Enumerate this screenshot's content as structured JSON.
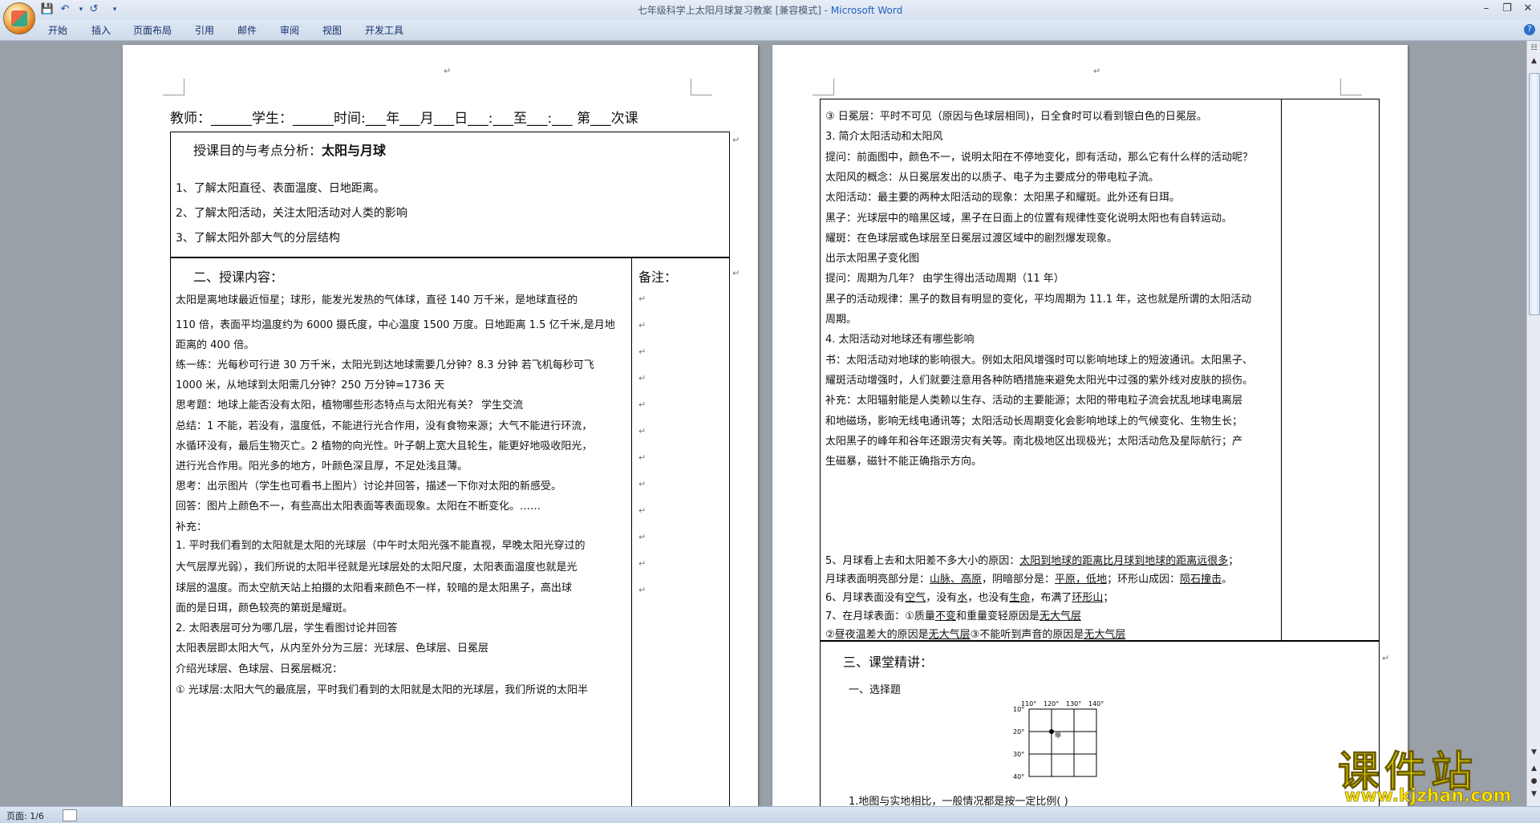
{
  "window": {
    "title": "七年级科学上太阳月球复习教案 [兼容模式] - ",
    "app_name": "Microsoft Word",
    "quick_access": [
      "save-icon",
      "undo-icon",
      "redo-icon",
      "customize-icon"
    ]
  },
  "ribbon": {
    "tabs": [
      "开始",
      "插入",
      "页面布局",
      "引用",
      "邮件",
      "审阅",
      "视图",
      "开发工具"
    ]
  },
  "page1": {
    "header_line": "教师：______学生：______时间:___年___月___日___:___至___:___   第___次课",
    "section1_title": "授课目的与考点分析：",
    "section1_topic": "太阳与月球",
    "goals": [
      "1、了解太阳直径、表面温度、日地距离。",
      "2、了解太阳活动，关注太阳活动对人类的影响",
      "3、了解太阳外部大气的分层结构"
    ],
    "section2_title": "二、授课内容：",
    "notes_label": "备注：",
    "content_lines": [
      "      太阳是离地球最近恒星；球形，能发光发热的气体球，直径 140 万千米，是地球直径的",
      "110 倍，表面平均温度约为 6000 摄氏度，中心温度 1500 万度。日地距离 1.5 亿千米,是月地",
      "距离的 400 倍。",
      "练一练：光每秒可行进 30 万千米，太阳光到达地球需要几分钟？8.3 分钟   若飞机每秒可飞",
      "1000 米，从地球到太阳需几分钟？250 万分钟=1736 天",
      "思考题：地球上能否没有太阳，植物哪些形态特点与太阳光有关？ 学生交流",
      "总结：1 不能，若没有，温度低，不能进行光合作用，没有食物来源；大气不能进行环流，",
      "水循环没有，最后生物灭亡。2 植物的向光性。叶子朝上宽大且轮生，能更好地吸收阳光，",
      "进行光合作用。阳光多的地方，叶颜色深且厚，不足处浅且薄。",
      "思考：出示图片（学生也可看书上图片）讨论并回答，描述一下你对太阳的新感受。",
      "回答：图片上颜色不一，有些高出太阳表面等表面现象。太阳在不断变化。……",
      "补充：",
      "1.  平时我们看到的太阳就是太阳的光球层（中午时太阳光强不能直视，早晚太阳光穿过的",
      "     大气层厚光弱），我们所说的太阳半径就是光球层处的太阳尺度，太阳表面温度也就是光",
      "     球层的温度。而太空航天站上拍摄的太阳看来颜色不一样，较暗的是太阳黑子，高出球",
      "     面的是日珥，颜色较亮的第斑是耀斑。",
      "2.  太阳表层可分为哪几层，学生看图讨论并回答",
      "太阳表层即太阳大气，从内至外分为三层：光球层、色球层、日冕层",
      "介绍光球层、色球层、日冕层概况：",
      "①  光球层:太阳大气的最底层，平时我们看到的太阳就是太阳的光球层，我们所说的太阳半"
    ]
  },
  "page2": {
    "content_lines": [
      "③  日冕层：平时不可见（原因与色球层相同)，日全食时可以看到银白色的日冕层。",
      "3. 简介太阳活动和太阳风",
      "提问：前面图中，颜色不一，说明太阳在不停地变化，即有活动，那么它有什么样的活动呢？",
      "太阳风的概念：从日冕层发出的以质子、电子为主要成分的带电粒子流。",
      "太阳活动：最主要的两种太阳活动的现象：太阳黑子和耀斑。此外还有日珥。",
      "黑子：光球层中的暗黑区域，黑子在日面上的位置有规律性变化说明太阳也有自转运动。",
      "耀斑：在色球层或色球层至日冕层过渡区域中的剧烈爆发现象。",
      "出示太阳黑子变化图",
      "提问：周期为几年？   由学生得出活动周期（11 年）",
      "黑子的活动规律：黑子的数目有明显的变化，平均周期为 11.1 年，这也就是所谓的太阳活动",
      "周期。",
      "4. 太阳活动对地球还有哪些影响",
      "书：太阳活动对地球的影响很大。例如太阳风增强时可以影响地球上的短波通讯。太阳黑子、",
      "耀斑活动增强时，人们就要注意用各种防晒措施来避免太阳光中过强的紫外线对皮肤的损伤。",
      "补充：太阳辐射能是人类赖以生存、活动的主要能源；太阳的带电粒子流会扰乱地球电离层",
      "和地磁场，影响无线电通讯等；太阳活动长周期变化会影响地球上的气候变化、生物生长；",
      "太阳黑子的峰年和谷年还跟涝灾有关等。南北极地区出现极光；太阳活动危及星际航行；产",
      "生磁暴，磁针不能正确指示方向。"
    ],
    "q5_a": "5、月球看上去和太阳差不多大小的原因：",
    "q5_b": "太阳到地球的距离比月球到地球的距离远很多",
    "q5_c": "月球表面明亮部分是：",
    "q5_d": "山脉、高原",
    "q5_e": "，阴暗部分是：",
    "q5_f": "平原，低地",
    "q5_g": "；环形山成因：",
    "q5_h": "陨石撞击",
    "q6_a": "6、月球表面没有",
    "q6_b": "空气",
    "q6_c": "，没有",
    "q6_d": "水",
    "q6_e": "，也没有",
    "q6_f": "生命",
    "q6_g": "，布满了",
    "q6_h": "环形山",
    "q7_a": "7、在月球表面：①质量",
    "q7_b": "不变",
    "q7_c": "和重量变轻原因是",
    "q7_d": "无大气层",
    "q7_e": "     ②昼夜温差大的原因是",
    "q7_f": "无大气层",
    "q7_g": "③不能听到声音的原因是",
    "q7_h": "无大气层",
    "section3_title": "三、课堂精讲：",
    "mc_title": "一、选择题",
    "map_lon_labels": [
      "110°",
      "120°",
      "130°",
      "140°"
    ],
    "map_lat_labels": [
      "10°",
      "20°",
      "30°",
      "40°"
    ],
    "map_point_label": "甲",
    "question1": "1.地图与实地相比，一般情况都是按一定比例(      )"
  },
  "statusbar": {
    "page_indicator": "页面: 1/6"
  },
  "watermark": {
    "main": "课件站",
    "url": "www.kjzhan.com"
  }
}
